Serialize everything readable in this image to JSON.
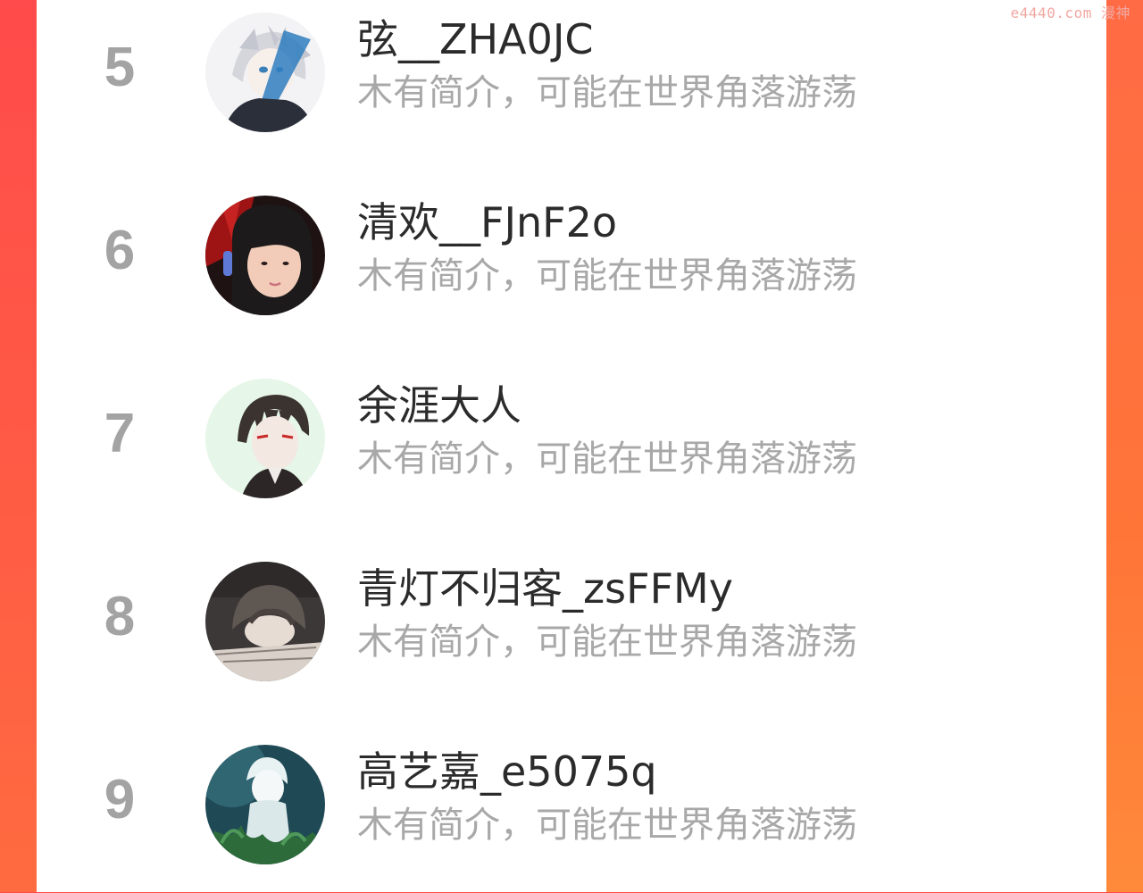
{
  "watermark": "e4440.com 漫神",
  "list": [
    {
      "rank": "5",
      "name": "弦__ZHA0JC",
      "bio": "木有简介，可能在世界角落游荡",
      "avatar_icon": "anime-boy-white-hair-avatar",
      "avatar_colors": [
        "#f4f4f6",
        "#c9ccd4",
        "#3b7fb8",
        "#2b2f3a"
      ]
    },
    {
      "rank": "6",
      "name": "清欢__FJnF2o",
      "bio": "木有简介，可能在世界角落游荡",
      "avatar_icon": "girl-photo-avatar",
      "avatar_colors": [
        "#2a1414",
        "#b21a1a",
        "#f1c9b4",
        "#222222"
      ]
    },
    {
      "rank": "7",
      "name": "余涯大人",
      "bio": "木有简介，可能在世界角落游荡",
      "avatar_icon": "anime-boy-red-eyes-avatar",
      "avatar_colors": [
        "#e3f5e6",
        "#3a3330",
        "#f1e6e0",
        "#c82828"
      ]
    },
    {
      "rank": "8",
      "name": "青灯不归客_zsFFMy",
      "bio": "木有简介，可能在世界角落游荡",
      "avatar_icon": "anime-sleeping-boy-avatar",
      "avatar_colors": [
        "#3d3838",
        "#6a625e",
        "#d9d1c9",
        "#231f1f"
      ]
    },
    {
      "rank": "9",
      "name": "高艺嘉_e5075q",
      "bio": "木有简介，可能在世界角落游荡",
      "avatar_icon": "anime-girl-in-plants-avatar",
      "avatar_colors": [
        "#1f4a55",
        "#5fa0a8",
        "#e8f0f0",
        "#2d6b3a"
      ]
    }
  ]
}
